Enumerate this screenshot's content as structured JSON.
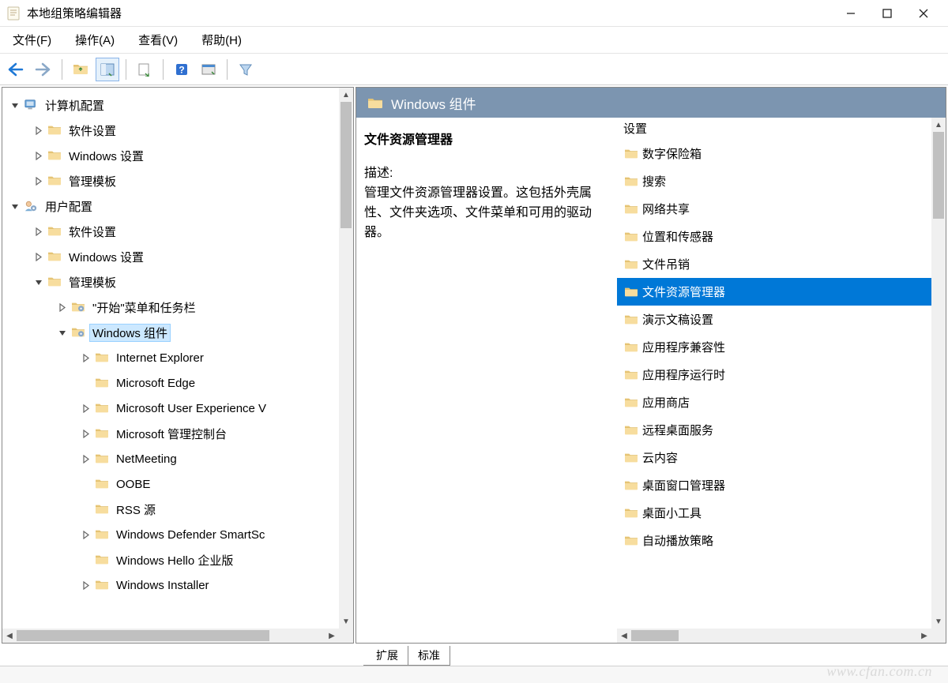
{
  "window": {
    "title": "本地组策略编辑器"
  },
  "menu": {
    "file": "文件(F)",
    "action": "操作(A)",
    "view": "查看(V)",
    "help": "帮助(H)"
  },
  "tree": [
    {
      "indent": 0,
      "toggle": "open",
      "icon": "computer",
      "label": "计算机配置"
    },
    {
      "indent": 1,
      "toggle": "closed",
      "icon": "folder",
      "label": "软件设置"
    },
    {
      "indent": 1,
      "toggle": "closed",
      "icon": "folder",
      "label": "Windows 设置"
    },
    {
      "indent": 1,
      "toggle": "closed",
      "icon": "folder",
      "label": "管理模板"
    },
    {
      "indent": 0,
      "toggle": "open",
      "icon": "user",
      "label": "用户配置"
    },
    {
      "indent": 1,
      "toggle": "closed",
      "icon": "folder",
      "label": "软件设置"
    },
    {
      "indent": 1,
      "toggle": "closed",
      "icon": "folder",
      "label": "Windows 设置"
    },
    {
      "indent": 1,
      "toggle": "open",
      "icon": "folder",
      "label": "管理模板"
    },
    {
      "indent": 2,
      "toggle": "closed",
      "icon": "folder-gear",
      "label": "\"开始\"菜单和任务栏"
    },
    {
      "indent": 2,
      "toggle": "open",
      "icon": "folder-gear",
      "label": "Windows 组件",
      "selected": true
    },
    {
      "indent": 3,
      "toggle": "closed",
      "icon": "folder",
      "label": "Internet Explorer"
    },
    {
      "indent": 3,
      "toggle": "none",
      "icon": "folder",
      "label": "Microsoft Edge"
    },
    {
      "indent": 3,
      "toggle": "closed",
      "icon": "folder",
      "label": "Microsoft User Experience V"
    },
    {
      "indent": 3,
      "toggle": "closed",
      "icon": "folder",
      "label": "Microsoft 管理控制台"
    },
    {
      "indent": 3,
      "toggle": "closed",
      "icon": "folder",
      "label": "NetMeeting"
    },
    {
      "indent": 3,
      "toggle": "none",
      "icon": "folder",
      "label": "OOBE"
    },
    {
      "indent": 3,
      "toggle": "none",
      "icon": "folder",
      "label": "RSS 源"
    },
    {
      "indent": 3,
      "toggle": "closed",
      "icon": "folder",
      "label": "Windows Defender SmartSc"
    },
    {
      "indent": 3,
      "toggle": "none",
      "icon": "folder",
      "label": "Windows Hello 企业版"
    },
    {
      "indent": 3,
      "toggle": "closed",
      "icon": "folder",
      "label": "Windows Installer"
    }
  ],
  "right": {
    "header": "Windows 组件",
    "desc_title": "文件资源管理器",
    "desc_label": "描述:",
    "desc_text": "管理文件资源管理器设置。这包括外壳属性、文件夹选项、文件菜单和可用的驱动器。",
    "list_header": "设置",
    "items": [
      {
        "label": "数字保险箱"
      },
      {
        "label": "搜索"
      },
      {
        "label": "网络共享"
      },
      {
        "label": "位置和传感器"
      },
      {
        "label": "文件吊销"
      },
      {
        "label": "文件资源管理器",
        "selected": true
      },
      {
        "label": "演示文稿设置"
      },
      {
        "label": "应用程序兼容性"
      },
      {
        "label": "应用程序运行时"
      },
      {
        "label": "应用商店"
      },
      {
        "label": "远程桌面服务"
      },
      {
        "label": "云内容"
      },
      {
        "label": "桌面窗口管理器"
      },
      {
        "label": "桌面小工具"
      },
      {
        "label": "自动播放策略"
      }
    ]
  },
  "tabs": {
    "extended": "扩展",
    "standard": "标准"
  },
  "watermark": "www.cfan.com.cn"
}
